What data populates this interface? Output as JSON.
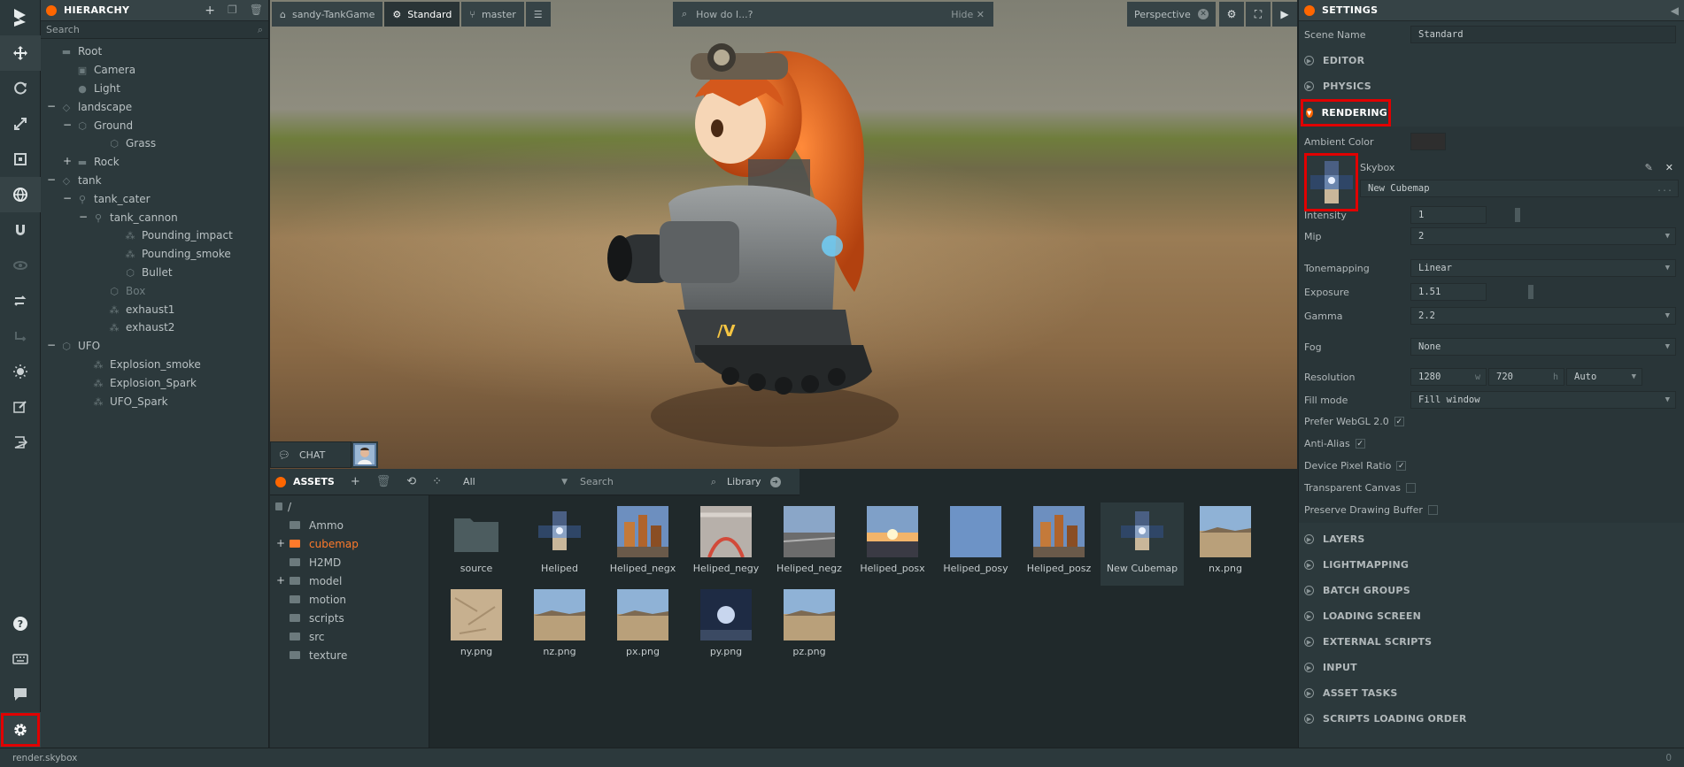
{
  "hierarchy": {
    "title": "HIERARCHY",
    "search_placeholder": "Search",
    "items": [
      {
        "label": "Root",
        "depth": 0,
        "toggle": "",
        "icon": "folder",
        "dim": false
      },
      {
        "label": "Camera",
        "depth": 1,
        "toggle": "",
        "icon": "camera",
        "dim": false
      },
      {
        "label": "Light",
        "depth": 1,
        "toggle": "",
        "icon": "light",
        "dim": false
      },
      {
        "label": "landscape",
        "depth": 0,
        "toggle": "−",
        "icon": "entity",
        "dim": false
      },
      {
        "label": "Ground",
        "depth": 1,
        "toggle": "−",
        "icon": "cube",
        "dim": false
      },
      {
        "label": "Grass",
        "depth": 3,
        "toggle": "",
        "icon": "cube",
        "dim": false
      },
      {
        "label": "Rock",
        "depth": 1,
        "toggle": "+",
        "icon": "folder",
        "dim": false
      },
      {
        "label": "tank",
        "depth": 0,
        "toggle": "−",
        "icon": "entity",
        "dim": false
      },
      {
        "label": "tank_cater",
        "depth": 1,
        "toggle": "−",
        "icon": "anim",
        "dim": false
      },
      {
        "label": "tank_cannon",
        "depth": 2,
        "toggle": "−",
        "icon": "anim",
        "dim": false
      },
      {
        "label": "Pounding_impact",
        "depth": 4,
        "toggle": "",
        "icon": "particle",
        "dim": false
      },
      {
        "label": "Pounding_smoke",
        "depth": 4,
        "toggle": "",
        "icon": "particle",
        "dim": false
      },
      {
        "label": "Bullet",
        "depth": 4,
        "toggle": "",
        "icon": "cube",
        "dim": false
      },
      {
        "label": "Box",
        "depth": 3,
        "toggle": "",
        "icon": "cube",
        "dim": true
      },
      {
        "label": "exhaust1",
        "depth": 3,
        "toggle": "",
        "icon": "particle",
        "dim": false
      },
      {
        "label": "exhaust2",
        "depth": 3,
        "toggle": "",
        "icon": "particle",
        "dim": false
      },
      {
        "label": "UFO",
        "depth": 0,
        "toggle": "−",
        "icon": "cube",
        "dim": false
      },
      {
        "label": "Explosion_smoke",
        "depth": 2,
        "toggle": "",
        "icon": "particle",
        "dim": false
      },
      {
        "label": "Explosion_Spark",
        "depth": 2,
        "toggle": "",
        "icon": "particle",
        "dim": false
      },
      {
        "label": "UFO_Spark",
        "depth": 2,
        "toggle": "",
        "icon": "particle",
        "dim": false
      }
    ]
  },
  "viewport": {
    "project": "sandy-TankGame",
    "scene": "Standard",
    "branch": "master",
    "howdo_placeholder": "How do I...?",
    "hide_label": "Hide",
    "camera": "Perspective"
  },
  "chat": {
    "label": "CHAT"
  },
  "assets": {
    "title": "ASSETS",
    "filter": "All",
    "search_placeholder": "Search",
    "library": "Library",
    "folders": [
      {
        "label": "/",
        "toggle": "",
        "active": false
      },
      {
        "label": "Ammo",
        "toggle": "",
        "active": false
      },
      {
        "label": "cubemap",
        "toggle": "+",
        "active": true
      },
      {
        "label": "H2MD",
        "toggle": "",
        "active": false
      },
      {
        "label": "model",
        "toggle": "+",
        "active": false
      },
      {
        "label": "motion",
        "toggle": "",
        "active": false
      },
      {
        "label": "scripts",
        "toggle": "",
        "active": false
      },
      {
        "label": "src",
        "toggle": "",
        "active": false
      },
      {
        "label": "texture",
        "toggle": "",
        "active": false
      }
    ],
    "files": [
      {
        "name": "source",
        "kind": "folder"
      },
      {
        "name": "Heliped",
        "kind": "cubemap"
      },
      {
        "name": "Heliped_negx",
        "kind": "city"
      },
      {
        "name": "Heliped_negy",
        "kind": "road"
      },
      {
        "name": "Heliped_negz",
        "kind": "sky"
      },
      {
        "name": "Heliped_posx",
        "kind": "sunset"
      },
      {
        "name": "Heliped_posy",
        "kind": "bluesky"
      },
      {
        "name": "Heliped_posz",
        "kind": "city"
      },
      {
        "name": "New Cubemap",
        "kind": "cubemap"
      },
      {
        "name": "nx.png",
        "kind": "desert"
      },
      {
        "name": "ny.png",
        "kind": "sand"
      },
      {
        "name": "nz.png",
        "kind": "desert"
      },
      {
        "name": "px.png",
        "kind": "desert"
      },
      {
        "name": "py.png",
        "kind": "night"
      },
      {
        "name": "pz.png",
        "kind": "desert"
      }
    ]
  },
  "settings": {
    "title": "SETTINGS",
    "scene_name_label": "Scene Name",
    "scene_name": "Standard",
    "sections_top": [
      "EDITOR",
      "PHYSICS"
    ],
    "rendering_label": "RENDERING",
    "ambient_label": "Ambient Color",
    "ambient_color": "#2e2e2e",
    "skybox_label": "Skybox",
    "skybox_asset": "New Cubemap",
    "skybox_more": "...",
    "intensity_label": "Intensity",
    "intensity": "1",
    "mip_label": "Mip",
    "mip": "2",
    "tonemapping_label": "Tonemapping",
    "tonemapping": "Linear",
    "exposure_label": "Exposure",
    "exposure": "1.51",
    "gamma_label": "Gamma",
    "gamma": "2.2",
    "fog_label": "Fog",
    "fog": "None",
    "resolution_label": "Resolution",
    "res_w": "1280",
    "res_w_unit": "w",
    "res_h": "720",
    "res_h_unit": "h",
    "res_mode": "Auto",
    "fill_label": "Fill mode",
    "fill": "Fill window",
    "webgl2_label": "Prefer WebGL 2.0",
    "antialias_label": "Anti-Alias",
    "dpr_label": "Device Pixel Ratio",
    "transparent_label": "Transparent Canvas",
    "preserve_label": "Preserve Drawing Buffer",
    "sections_bottom": [
      "LAYERS",
      "LIGHTMAPPING",
      "BATCH GROUPS",
      "LOADING SCREEN",
      "EXTERNAL SCRIPTS",
      "INPUT",
      "ASSET TASKS",
      "SCRIPTS LOADING ORDER"
    ]
  },
  "status": {
    "path": "render.skybox",
    "right": "0"
  }
}
